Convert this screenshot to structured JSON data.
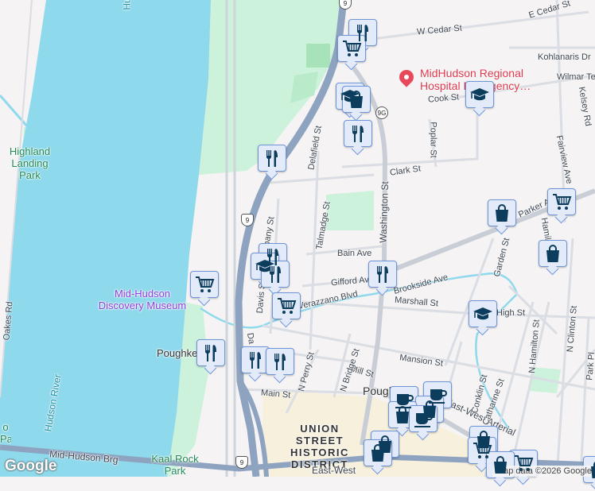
{
  "map": {
    "water_color": "#8fd9ec",
    "park_color": "#cdf2dc",
    "highway_color": "#8ea3bf",
    "marker_color": "#0d3d5c",
    "labels": {
      "hudson_top": "Hu",
      "hudson_river": "Hudson River",
      "highland_landing_park": "Highland Landing Park",
      "kaal_rock_park": "Kaal Rock Park",
      "hospital": "MidHudson Regional Hospital Emergency…",
      "museum": "Mid-Hudson Discovery Museum",
      "district": "UNION STREET HISTORIC DISTRICT",
      "city": "Pough",
      "city_left": "Poughke",
      "bridge": "Mid-Hudson Brg",
      "east_west": "East-West",
      "east_west_2": "East-West Arterial",
      "partial_left_park": "o Park"
    },
    "streets": {
      "e_cedar": "E Cedar St",
      "w_cedar": "W Cedar St",
      "kohlanaris": "Kohlanaris Dr",
      "wilmar": "Wilmar Te",
      "cook": "Cook St",
      "poplar": "Poplar St",
      "kelsey": "Kelsey Rd",
      "fairview": "Fairview Ave",
      "delafield": "Delafield St",
      "clark": "Clark St",
      "washington": "Washington St",
      "talmadge": "Talmadge St",
      "parker": "Parker Ave",
      "hamilton_top": "Hamil",
      "bain": "Bain Ave",
      "gifford": "Gifford Ave",
      "brookside": "Brookside Ave",
      "verazzano": "Verazzano Blvd",
      "marshall": "Marshall St",
      "garden": "Garden St",
      "high": "High St",
      "mansion": "Mansion St",
      "mill": "Mill St",
      "n_bridge": "N Bridge St",
      "n_perry": "N Perry St",
      "conklin": "Conklin St",
      "catharine": "Catharine St",
      "n_hamilton": "N Hamilton St",
      "n_clinton": "N Clinton St",
      "park_pl": "Park Pl",
      "main": "Main St",
      "davis": "Davis St",
      "albany": "Albany St",
      "oakes": "Oakes Rd",
      "dutchess": "Da"
    },
    "shields": {
      "us9": "9",
      "ny9g": "9G"
    },
    "attribution": "Map data ©2026 Google",
    "logo": "Google"
  }
}
